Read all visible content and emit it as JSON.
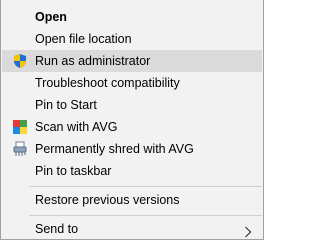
{
  "menu": {
    "items": [
      {
        "label": "Open",
        "icon": "",
        "bold": true
      },
      {
        "label": "Open file location",
        "icon": ""
      },
      {
        "label": "Run as administrator",
        "icon": "uac-shield-icon",
        "highlighted": true
      },
      {
        "label": "Troubleshoot compatibility",
        "icon": ""
      },
      {
        "label": "Pin to Start",
        "icon": ""
      },
      {
        "label": "Scan with AVG",
        "icon": "avg-icon"
      },
      {
        "label": "Permanently shred with AVG",
        "icon": "shredder-icon"
      },
      {
        "label": "Pin to taskbar",
        "icon": ""
      },
      {
        "label": "Restore previous versions",
        "icon": ""
      },
      {
        "label": "Send to",
        "icon": "",
        "submenu": true
      }
    ]
  },
  "colors": {
    "menu_bg": "#f2f2f2",
    "highlight_bg": "#dadada",
    "separator": "#cfcfcf",
    "shield_blue": "#1e6fd9",
    "shield_yellow": "#f5c400",
    "avg_red": "#e53935",
    "avg_green": "#43a047",
    "avg_blue": "#1e88e5",
    "avg_yellow": "#fdd835"
  }
}
